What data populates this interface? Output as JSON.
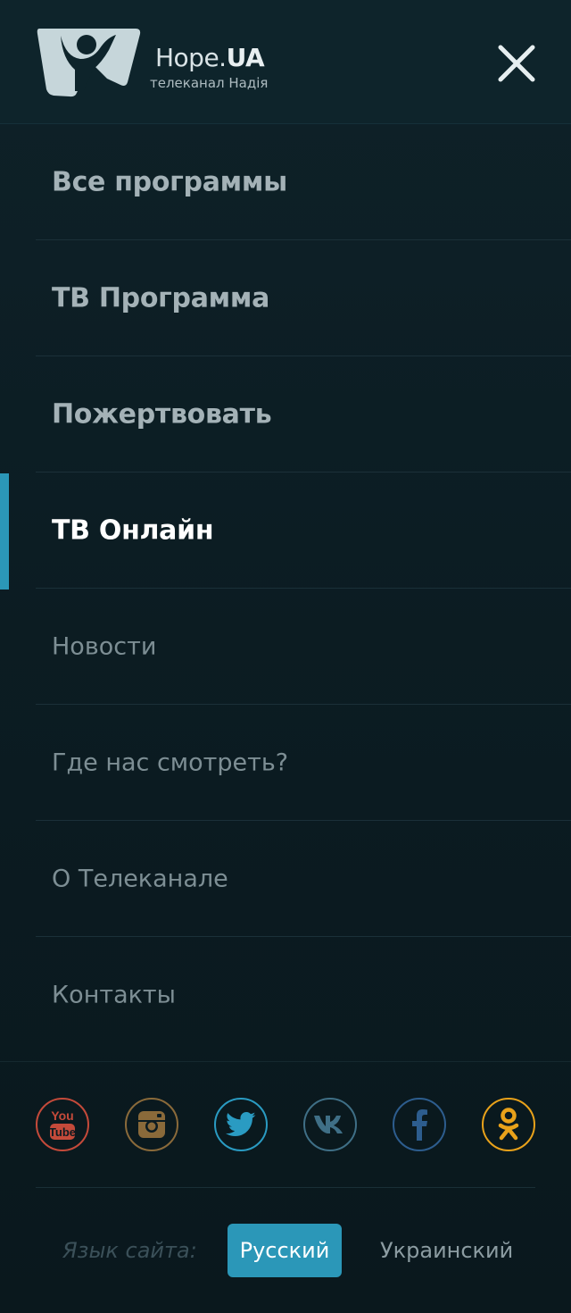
{
  "header": {
    "logo_name_regular": "Hope.",
    "logo_name_bold": "UA",
    "logo_tagline": "телеканал Надія"
  },
  "menu": {
    "items": [
      {
        "label": "Все программы",
        "style": "primary",
        "active": false
      },
      {
        "label": "ТВ Программа",
        "style": "primary",
        "active": false
      },
      {
        "label": "Пожертвовать",
        "style": "primary",
        "active": false
      },
      {
        "label": "ТВ Онлайн",
        "style": "primary",
        "active": true
      },
      {
        "label": "Новости",
        "style": "secondary",
        "active": false
      },
      {
        "label": "Где нас смотреть?",
        "style": "secondary",
        "active": false
      },
      {
        "label": "О Телеканале",
        "style": "secondary",
        "active": false
      },
      {
        "label": "Контакты",
        "style": "secondary",
        "active": false
      }
    ]
  },
  "social": {
    "items": [
      {
        "icon": "youtube-icon",
        "color": "#c44a3a"
      },
      {
        "icon": "instagram-icon",
        "color": "#8a6a3a"
      },
      {
        "icon": "twitter-icon",
        "color": "#2a9bc2"
      },
      {
        "icon": "vk-icon",
        "color": "#3f6f86"
      },
      {
        "icon": "facebook-icon",
        "color": "#2d5d8e"
      },
      {
        "icon": "odnoklassniki-icon",
        "color": "#e9a21a"
      }
    ]
  },
  "language": {
    "caption": "Язык сайта:",
    "selected": "Русский",
    "other": "Украинский"
  },
  "colors": {
    "accent": "#2b97b8",
    "background": "#0b1b21"
  }
}
